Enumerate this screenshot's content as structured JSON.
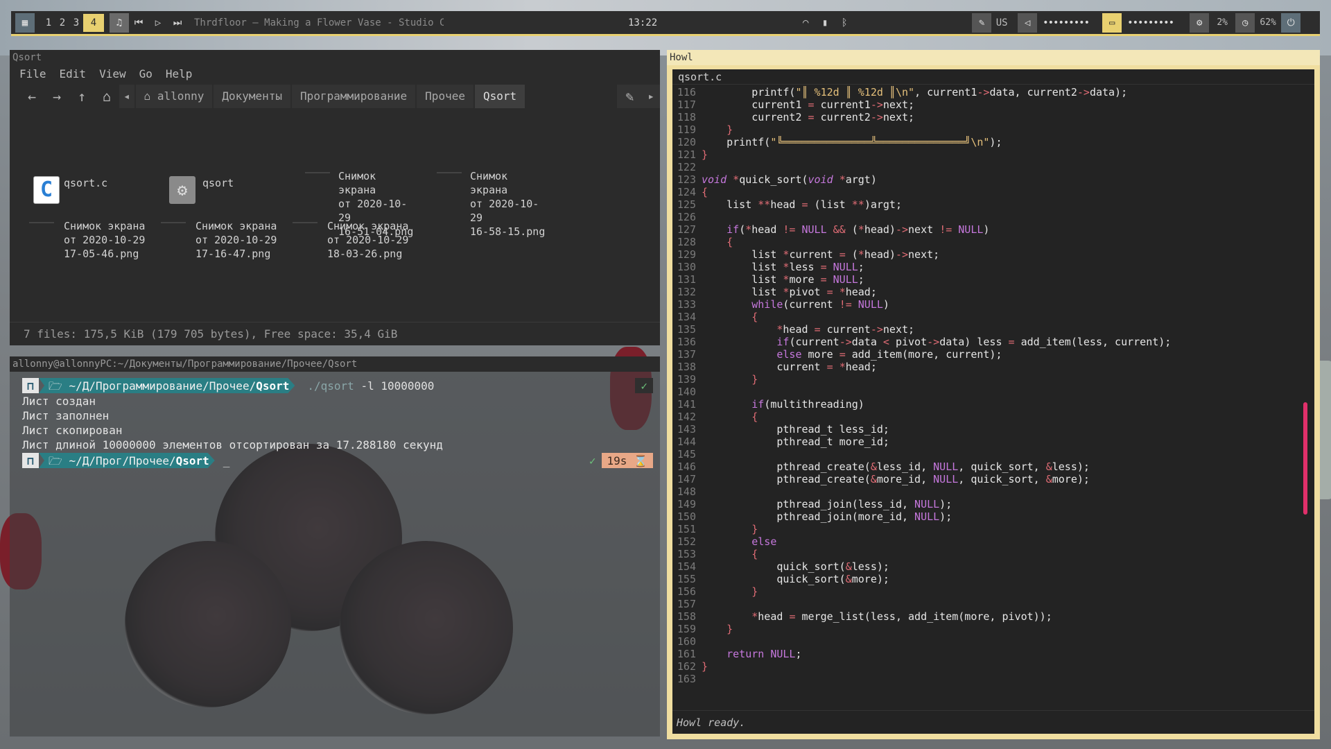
{
  "topbar": {
    "workspaces": [
      "1",
      "2",
      "3",
      "4"
    ],
    "active_workspace": "4",
    "now_playing": "Thrdfloor — Making a Flower Vase - Studio Cer...",
    "clock": "13:22",
    "keyboard_layout": "US",
    "volume_dots": "•••••••••",
    "brightness_dots": "•••••••••",
    "cpu": "2%",
    "memory": "62%",
    "accent_color": "#e8d070"
  },
  "file_manager": {
    "title": "Qsort",
    "menu": [
      "File",
      "Edit",
      "View",
      "Go",
      "Help"
    ],
    "breadcrumbs": [
      "allonny",
      "Документы",
      "Программирование",
      "Прочее",
      "Qsort"
    ],
    "files": [
      {
        "name": "qsort.c",
        "icon": "c-source-icon"
      },
      {
        "name": "qsort",
        "icon": "executable-icon"
      },
      {
        "name": "Снимок экрана\nот 2020-10-29\n16-51-04.png",
        "icon": "image-icon"
      },
      {
        "name": "Снимок экрана\nот 2020-10-29\n16-58-15.png",
        "icon": "image-icon"
      },
      {
        "name": "Снимок экрана\nот 2020-10-29\n17-05-46.png",
        "icon": "image-icon"
      },
      {
        "name": "Снимок экрана\nот 2020-10-29\n17-16-47.png",
        "icon": "image-icon"
      },
      {
        "name": "Снимок экрана\nот 2020-10-29\n18-03-26.png",
        "icon": "image-icon"
      }
    ],
    "status": "7 files: 175,5 KiB (179 705 bytes), Free space: 35,4 GiB"
  },
  "terminal": {
    "title": "allonny@allonnyPC:~/Документы/Программирование/Прочее/Qsort",
    "prompt1_path": "~/Д/Программирование/Прочее/",
    "prompt1_dir": "Qsort",
    "command_prog": "./qsort",
    "command_args": " -l 10000000",
    "output": [
      "Лист создан",
      "Лист заполнен",
      "Лист скопирован",
      "Лист длиной 10000000 элементов отсортирован за 17.288180 секунд"
    ],
    "prompt2_path": "~/Д/Прог/Прочее/",
    "prompt2_dir": "Qsort",
    "cursor": "_",
    "ok_mark": "✓",
    "duration": "19s"
  },
  "editor": {
    "title": "Howl",
    "file_tab": "qsort.c",
    "status": "Howl ready.",
    "lines": [
      {
        "no": "116",
        "html": "        printf(<span class='s'>\"║ %12d ║ %12d ║\\n\"</span>, current1<span class='o'>-&gt;</span>data, current2<span class='o'>-&gt;</span>data);"
      },
      {
        "no": "117",
        "html": "        current1 <span class='o'>=</span> current1<span class='o'>-&gt;</span>next;"
      },
      {
        "no": "118",
        "html": "        current2 <span class='o'>=</span> current2<span class='o'>-&gt;</span>next;"
      },
      {
        "no": "119",
        "html": "    <span class='o'>}</span>"
      },
      {
        "no": "120",
        "html": "    printf(<span class='s'>\"╚══════════════╩══════════════╝\\n\"</span>);"
      },
      {
        "no": "121",
        "html": "<span class='o'>}</span>"
      },
      {
        "no": "122",
        "html": ""
      },
      {
        "no": "123",
        "html": "<span class='t'>void</span> <span class='o'>*</span>quick_sort(<span class='t'>void</span> <span class='o'>*</span>argt)"
      },
      {
        "no": "124",
        "html": "<span class='o'>{</span>"
      },
      {
        "no": "125",
        "html": "    list <span class='o'>**</span>head <span class='o'>=</span> (list <span class='o'>**</span>)argt;"
      },
      {
        "no": "126",
        "html": ""
      },
      {
        "no": "127",
        "html": "    <span class='k'>if</span>(<span class='o'>*</span>head <span class='o'>!=</span> <span class='n'>NULL</span> <span class='o'>&amp;&amp;</span> (<span class='o'>*</span>head)<span class='o'>-&gt;</span>next <span class='o'>!=</span> <span class='n'>NULL</span>)"
      },
      {
        "no": "128",
        "html": "    <span class='o'>{</span>"
      },
      {
        "no": "129",
        "html": "        list <span class='o'>*</span>current <span class='o'>=</span> (<span class='o'>*</span>head)<span class='o'>-&gt;</span>next;"
      },
      {
        "no": "130",
        "html": "        list <span class='o'>*</span>less <span class='o'>=</span> <span class='n'>NULL</span>;"
      },
      {
        "no": "131",
        "html": "        list <span class='o'>*</span>more <span class='o'>=</span> <span class='n'>NULL</span>;"
      },
      {
        "no": "132",
        "html": "        list <span class='o'>*</span>pivot <span class='o'>=</span> <span class='o'>*</span>head;"
      },
      {
        "no": "133",
        "html": "        <span class='k'>while</span>(current <span class='o'>!=</span> <span class='n'>NULL</span>)"
      },
      {
        "no": "134",
        "html": "        <span class='o'>{</span>"
      },
      {
        "no": "135",
        "html": "            <span class='o'>*</span>head <span class='o'>=</span> current<span class='o'>-&gt;</span>next;"
      },
      {
        "no": "136",
        "html": "            <span class='k'>if</span>(current<span class='o'>-&gt;</span>data <span class='o'>&lt;</span> pivot<span class='o'>-&gt;</span>data) less <span class='o'>=</span> add_item(less, current);"
      },
      {
        "no": "137",
        "html": "            <span class='k'>else</span> more <span class='o'>=</span> add_item(more, current);"
      },
      {
        "no": "138",
        "html": "            current <span class='o'>=</span> <span class='o'>*</span>head;"
      },
      {
        "no": "139",
        "html": "        <span class='o'>}</span>"
      },
      {
        "no": "140",
        "html": ""
      },
      {
        "no": "141",
        "html": "        <span class='k'>if</span>(multithreading)"
      },
      {
        "no": "142",
        "html": "        <span class='o'>{</span>"
      },
      {
        "no": "143",
        "html": "            pthread_t less_id;"
      },
      {
        "no": "144",
        "html": "            pthread_t more_id;"
      },
      {
        "no": "145",
        "html": ""
      },
      {
        "no": "146",
        "html": "            pthread_create(<span class='o'>&amp;</span>less_id, <span class='n'>NULL</span>, quick_sort, <span class='o'>&amp;</span>less);"
      },
      {
        "no": "147",
        "html": "            pthread_create(<span class='o'>&amp;</span>more_id, <span class='n'>NULL</span>, quick_sort, <span class='o'>&amp;</span>more);"
      },
      {
        "no": "148",
        "html": ""
      },
      {
        "no": "149",
        "html": "            pthread_join(less_id, <span class='n'>NULL</span>);"
      },
      {
        "no": "150",
        "html": "            pthread_join(more_id, <span class='n'>NULL</span>);"
      },
      {
        "no": "151",
        "html": "        <span class='o'>}</span>"
      },
      {
        "no": "152",
        "html": "        <span class='k'>else</span>"
      },
      {
        "no": "153",
        "html": "        <span class='o'>{</span>"
      },
      {
        "no": "154",
        "html": "            quick_sort(<span class='o'>&amp;</span>less);"
      },
      {
        "no": "155",
        "html": "            quick_sort(<span class='o'>&amp;</span>more);"
      },
      {
        "no": "156",
        "html": "        <span class='o'>}</span>"
      },
      {
        "no": "157",
        "html": ""
      },
      {
        "no": "158",
        "html": "        <span class='o'>*</span>head <span class='o'>=</span> merge_list(less, add_item(more, pivot));"
      },
      {
        "no": "159",
        "html": "    <span class='o'>}</span>"
      },
      {
        "no": "160",
        "html": ""
      },
      {
        "no": "161",
        "html": "    <span class='k'>return</span> <span class='n'>NULL</span>;"
      },
      {
        "no": "162",
        "html": "<span class='o'>}</span>"
      },
      {
        "no": "163",
        "html": ""
      }
    ]
  }
}
